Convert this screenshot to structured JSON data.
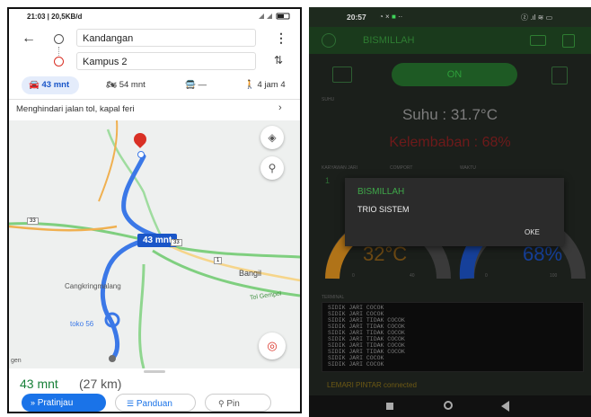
{
  "left_phone": {
    "status": {
      "time": "21:03 | 20,5KB/d",
      "icons": "signal-wifi-battery"
    },
    "origin": "Kandangan",
    "destination": "Kampus 2",
    "modes": [
      {
        "icon": "car-icon",
        "label": "43 mnt",
        "active": true
      },
      {
        "icon": "motorbike-icon",
        "label": "54 mnt",
        "active": false
      },
      {
        "icon": "transit-icon",
        "label": "—",
        "active": false
      },
      {
        "icon": "walk-icon",
        "label": "4 jam 4",
        "active": false
      }
    ],
    "avoid_text": "Menghindari jalan tol, kapal feri",
    "map_labels": {
      "route_time": "43 mnt",
      "bangil": "Bangil",
      "cangkring": "Cangkringmalang",
      "toko": "toko 56",
      "tol": "Tol Gempol",
      "gen": "gen",
      "road_shields": [
        "33",
        "33",
        "1"
      ]
    },
    "summary": {
      "time": "43 mnt",
      "distance": "(27 km)"
    },
    "buttons": {
      "preview": "Pratinjau",
      "guide": "Panduan",
      "pin": "Pin"
    }
  },
  "right_phone": {
    "status": {
      "time": "20:57"
    },
    "app_title": "BISMILLAH",
    "on_button": "ON",
    "suhu_label": "SUHU",
    "temperature": "Suhu : 31.7°C",
    "humidity": "Kelembaban : 68%",
    "sub_labels": [
      "KARYAWAN JARI",
      "COMPORT",
      "WAKTU"
    ],
    "sub_value": "1",
    "gauge_left": {
      "value": "32°C",
      "min": "0",
      "max": "40"
    },
    "gauge_right": {
      "value": "68%",
      "min": "0",
      "max": "100"
    },
    "dialog": {
      "title": "BISMILLAH",
      "message": "TRIO SISTEM",
      "ok": "OKE"
    },
    "terminal_label": "TERMINAL",
    "log_lines": [
      "SIDIK JARI COCOK",
      "SIDIK JARI COCOK",
      "SIDIK JARI TIDAK COCOK",
      "SIDIK JARI TIDAK COCOK",
      "SIDIK JARI TIDAK COCOK",
      "SIDIK JARI TIDAK COCOK",
      "SIDIK JARI TIDAK COCOK",
      "SIDIK JARI TIDAK COCOK",
      "SIDIK JARI COCOK",
      "SIDIK JARI COCOK"
    ],
    "connection": "LEMARI PINTAR connected",
    "colors": {
      "accent": "#2e7d32",
      "humidity_red": "#c62828",
      "gauge_orange": "#f0a020",
      "gauge_blue": "#1e5fd0"
    }
  }
}
